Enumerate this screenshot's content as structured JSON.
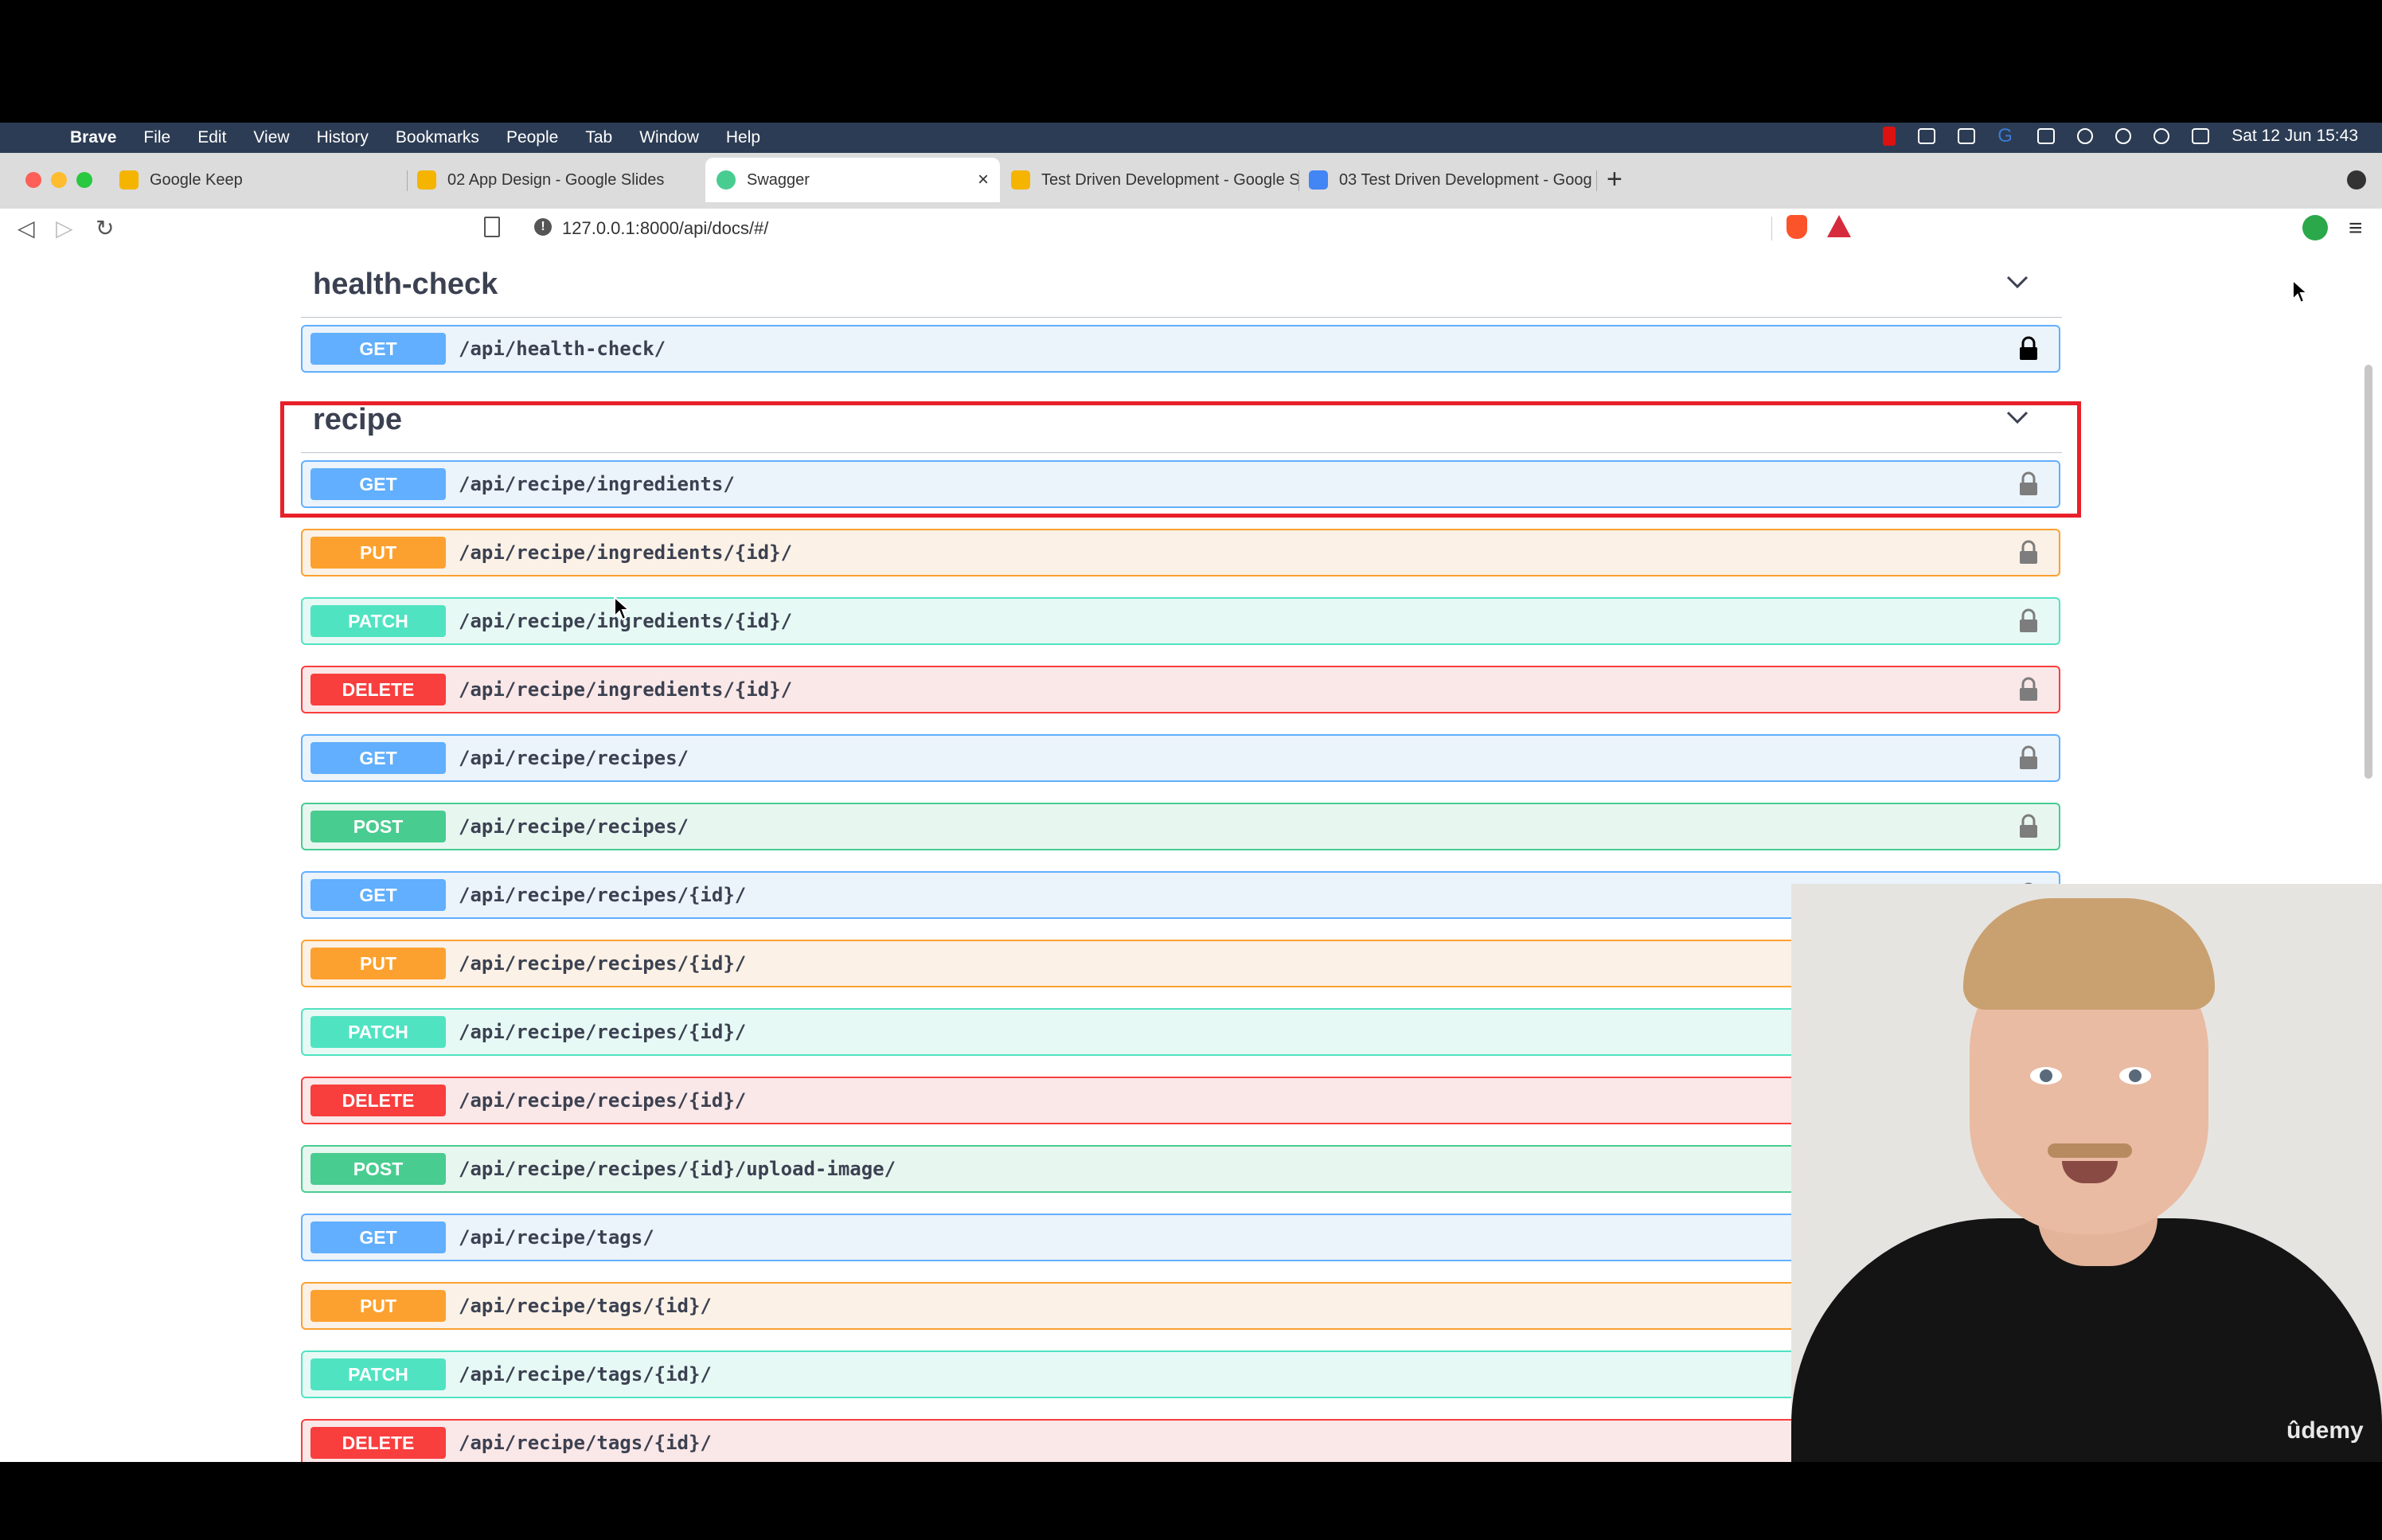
{
  "menubar": {
    "app": "Brave",
    "items": [
      "File",
      "Edit",
      "View",
      "History",
      "Bookmarks",
      "People",
      "Tab",
      "Window",
      "Help"
    ],
    "clock": "Sat 12 Jun  15:43"
  },
  "tabs": [
    {
      "title": "Google Keep",
      "color": "#f4b400"
    },
    {
      "title": "02 App Design - Google Slides",
      "color": "#f4b400"
    },
    {
      "title": "Swagger",
      "color": "#49cc90",
      "active": true
    },
    {
      "title": "Test Driven Development - Google S",
      "color": "#f4b400"
    },
    {
      "title": "03 Test Driven Development - Goog",
      "color": "#4285f4"
    }
  ],
  "toolbar": {
    "url": "127.0.0.1:8000/api/docs/#/"
  },
  "sections": [
    {
      "title": "health-check",
      "operations": [
        {
          "method": "GET",
          "path": "/api/health-check/"
        }
      ]
    },
    {
      "title": "recipe",
      "operations": [
        {
          "method": "GET",
          "path": "/api/recipe/ingredients/"
        },
        {
          "method": "PUT",
          "path": "/api/recipe/ingredients/{id}/"
        },
        {
          "method": "PATCH",
          "path": "/api/recipe/ingredients/{id}/"
        },
        {
          "method": "DELETE",
          "path": "/api/recipe/ingredients/{id}/"
        },
        {
          "method": "GET",
          "path": "/api/recipe/recipes/"
        },
        {
          "method": "POST",
          "path": "/api/recipe/recipes/"
        },
        {
          "method": "GET",
          "path": "/api/recipe/recipes/{id}/"
        },
        {
          "method": "PUT",
          "path": "/api/recipe/recipes/{id}/"
        },
        {
          "method": "PATCH",
          "path": "/api/recipe/recipes/{id}/"
        },
        {
          "method": "DELETE",
          "path": "/api/recipe/recipes/{id}/"
        },
        {
          "method": "POST",
          "path": "/api/recipe/recipes/{id}/upload-image/"
        },
        {
          "method": "GET",
          "path": "/api/recipe/tags/"
        },
        {
          "method": "PUT",
          "path": "/api/recipe/tags/{id}/"
        },
        {
          "method": "PATCH",
          "path": "/api/recipe/tags/{id}/"
        },
        {
          "method": "DELETE",
          "path": "/api/recipe/tags/{id}/"
        }
      ]
    }
  ],
  "watermark": "ûdemy"
}
